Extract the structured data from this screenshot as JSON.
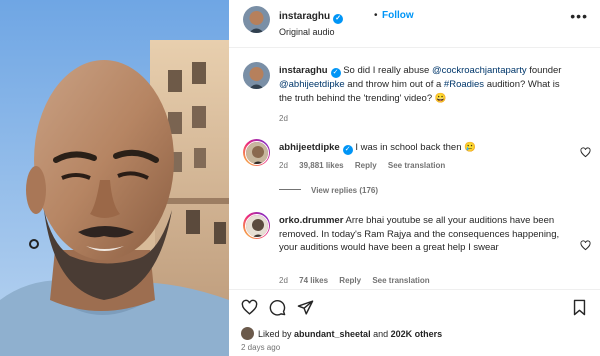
{
  "header": {
    "username": "instaraghu",
    "separator": "•",
    "follow_label": "Follow",
    "audio": "Original audio",
    "more": "•••"
  },
  "caption": {
    "username": "instaraghu",
    "text_1": "So did I really abuse",
    "mention_1": "@cockroachjantaparty",
    "text_2": "founder",
    "mention_2": "@abhijeetdipke",
    "text_3": "and throw him out of a",
    "mention_3": "#Roadies",
    "text_4": "audition? What is the truth behind the 'trending' video? 😀",
    "time": "2d"
  },
  "comments": [
    {
      "username": "abhijeetdipke",
      "text": "I was in school back then 🥲",
      "time": "2d",
      "likes": "39,881 likes",
      "reply": "Reply",
      "translation": "See translation"
    },
    {
      "username": "orko.drummer",
      "text": "Arre bhai youtube se all your auditions have been removed. In today's Ram Rajya and the consequences happening, your auditions would have been a great help I swear",
      "time": "2d",
      "likes": "74 likes",
      "reply": "Reply",
      "translation": "See translation"
    }
  ],
  "view_replies": "View replies (176)",
  "footer": {
    "liked_prefix": "Liked by",
    "liked_user": "abundant_sheetal",
    "liked_and": "and",
    "liked_count": "202K others",
    "ago": "2 days ago"
  },
  "icons": [
    "verified-icon",
    "more-icon",
    "heart-icon",
    "comment-icon",
    "share-icon",
    "save-icon"
  ],
  "colors": {
    "accent": "#0095f6",
    "mention": "#00376b",
    "muted": "#737373",
    "text": "#262626"
  }
}
